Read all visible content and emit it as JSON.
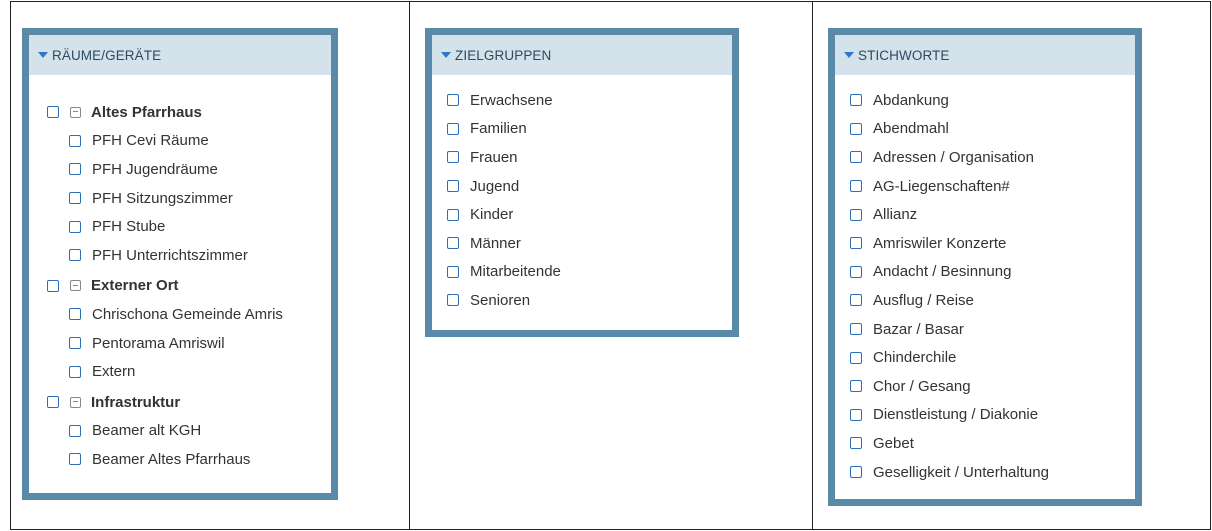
{
  "colors": {
    "panel_border": "#5b8aa8",
    "header_bg": "#d3e2eb",
    "checkbox": "#2b6fb8",
    "caret": "#2f78c4"
  },
  "rooms": {
    "title": "RÄUME/GERÄTE",
    "groups": [
      {
        "label": "Altes Pfarrhaus",
        "items": [
          "PFH Cevi Räume",
          "PFH Jugendräume",
          "PFH Sitzungszimmer",
          "PFH Stube",
          "PFH Unterrichtszimmer"
        ]
      },
      {
        "label": "Externer Ort",
        "items": [
          "Chrischona Gemeinde Amris",
          "Pentorama Amriswil",
          "Extern"
        ]
      },
      {
        "label": "Infrastruktur",
        "items": [
          "Beamer alt KGH",
          "Beamer Altes Pfarrhaus"
        ]
      }
    ]
  },
  "target_groups": {
    "title": "ZIELGRUPPEN",
    "items": [
      "Erwachsene",
      "Familien",
      "Frauen",
      "Jugend",
      "Kinder",
      "Männer",
      "Mitarbeitende",
      "Senioren"
    ]
  },
  "keywords": {
    "title": "STICHWORTE",
    "items": [
      "Abdankung",
      "Abendmahl",
      "Adressen / Organisation",
      "AG-Liegenschaften#",
      "Allianz",
      "Amriswiler Konzerte",
      "Andacht / Besinnung",
      "Ausflug / Reise",
      "Bazar / Basar",
      "Chinderchile",
      "Chor / Gesang",
      "Dienstleistung / Diakonie",
      "Gebet",
      "Geselligkeit / Unterhaltung"
    ]
  }
}
